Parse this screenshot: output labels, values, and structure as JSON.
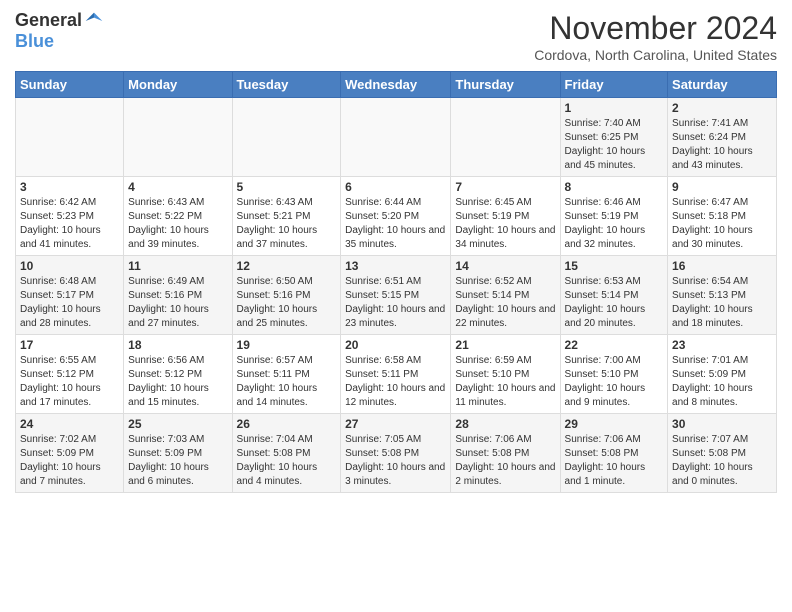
{
  "header": {
    "logo_general": "General",
    "logo_blue": "Blue",
    "month_title": "November 2024",
    "location": "Cordova, North Carolina, United States"
  },
  "calendar": {
    "weekdays": [
      "Sunday",
      "Monday",
      "Tuesday",
      "Wednesday",
      "Thursday",
      "Friday",
      "Saturday"
    ],
    "weeks": [
      [
        {
          "day": "",
          "empty": true
        },
        {
          "day": "",
          "empty": true
        },
        {
          "day": "",
          "empty": true
        },
        {
          "day": "",
          "empty": true
        },
        {
          "day": "",
          "empty": true
        },
        {
          "day": "1",
          "sunrise": "7:40 AM",
          "sunset": "6:25 PM",
          "daylight": "10 hours and 45 minutes."
        },
        {
          "day": "2",
          "sunrise": "7:41 AM",
          "sunset": "6:24 PM",
          "daylight": "10 hours and 43 minutes."
        }
      ],
      [
        {
          "day": "3",
          "sunrise": "6:42 AM",
          "sunset": "5:23 PM",
          "daylight": "10 hours and 41 minutes."
        },
        {
          "day": "4",
          "sunrise": "6:43 AM",
          "sunset": "5:22 PM",
          "daylight": "10 hours and 39 minutes."
        },
        {
          "day": "5",
          "sunrise": "6:43 AM",
          "sunset": "5:21 PM",
          "daylight": "10 hours and 37 minutes."
        },
        {
          "day": "6",
          "sunrise": "6:44 AM",
          "sunset": "5:20 PM",
          "daylight": "10 hours and 35 minutes."
        },
        {
          "day": "7",
          "sunrise": "6:45 AM",
          "sunset": "5:19 PM",
          "daylight": "10 hours and 34 minutes."
        },
        {
          "day": "8",
          "sunrise": "6:46 AM",
          "sunset": "5:19 PM",
          "daylight": "10 hours and 32 minutes."
        },
        {
          "day": "9",
          "sunrise": "6:47 AM",
          "sunset": "5:18 PM",
          "daylight": "10 hours and 30 minutes."
        }
      ],
      [
        {
          "day": "10",
          "sunrise": "6:48 AM",
          "sunset": "5:17 PM",
          "daylight": "10 hours and 28 minutes."
        },
        {
          "day": "11",
          "sunrise": "6:49 AM",
          "sunset": "5:16 PM",
          "daylight": "10 hours and 27 minutes."
        },
        {
          "day": "12",
          "sunrise": "6:50 AM",
          "sunset": "5:16 PM",
          "daylight": "10 hours and 25 minutes."
        },
        {
          "day": "13",
          "sunrise": "6:51 AM",
          "sunset": "5:15 PM",
          "daylight": "10 hours and 23 minutes."
        },
        {
          "day": "14",
          "sunrise": "6:52 AM",
          "sunset": "5:14 PM",
          "daylight": "10 hours and 22 minutes."
        },
        {
          "day": "15",
          "sunrise": "6:53 AM",
          "sunset": "5:14 PM",
          "daylight": "10 hours and 20 minutes."
        },
        {
          "day": "16",
          "sunrise": "6:54 AM",
          "sunset": "5:13 PM",
          "daylight": "10 hours and 18 minutes."
        }
      ],
      [
        {
          "day": "17",
          "sunrise": "6:55 AM",
          "sunset": "5:12 PM",
          "daylight": "10 hours and 17 minutes."
        },
        {
          "day": "18",
          "sunrise": "6:56 AM",
          "sunset": "5:12 PM",
          "daylight": "10 hours and 15 minutes."
        },
        {
          "day": "19",
          "sunrise": "6:57 AM",
          "sunset": "5:11 PM",
          "daylight": "10 hours and 14 minutes."
        },
        {
          "day": "20",
          "sunrise": "6:58 AM",
          "sunset": "5:11 PM",
          "daylight": "10 hours and 12 minutes."
        },
        {
          "day": "21",
          "sunrise": "6:59 AM",
          "sunset": "5:10 PM",
          "daylight": "10 hours and 11 minutes."
        },
        {
          "day": "22",
          "sunrise": "7:00 AM",
          "sunset": "5:10 PM",
          "daylight": "10 hours and 9 minutes."
        },
        {
          "day": "23",
          "sunrise": "7:01 AM",
          "sunset": "5:09 PM",
          "daylight": "10 hours and 8 minutes."
        }
      ],
      [
        {
          "day": "24",
          "sunrise": "7:02 AM",
          "sunset": "5:09 PM",
          "daylight": "10 hours and 7 minutes."
        },
        {
          "day": "25",
          "sunrise": "7:03 AM",
          "sunset": "5:09 PM",
          "daylight": "10 hours and 6 minutes."
        },
        {
          "day": "26",
          "sunrise": "7:04 AM",
          "sunset": "5:08 PM",
          "daylight": "10 hours and 4 minutes."
        },
        {
          "day": "27",
          "sunrise": "7:05 AM",
          "sunset": "5:08 PM",
          "daylight": "10 hours and 3 minutes."
        },
        {
          "day": "28",
          "sunrise": "7:06 AM",
          "sunset": "5:08 PM",
          "daylight": "10 hours and 2 minutes."
        },
        {
          "day": "29",
          "sunrise": "7:06 AM",
          "sunset": "5:08 PM",
          "daylight": "10 hours and 1 minute."
        },
        {
          "day": "30",
          "sunrise": "7:07 AM",
          "sunset": "5:08 PM",
          "daylight": "10 hours and 0 minutes."
        }
      ]
    ]
  }
}
